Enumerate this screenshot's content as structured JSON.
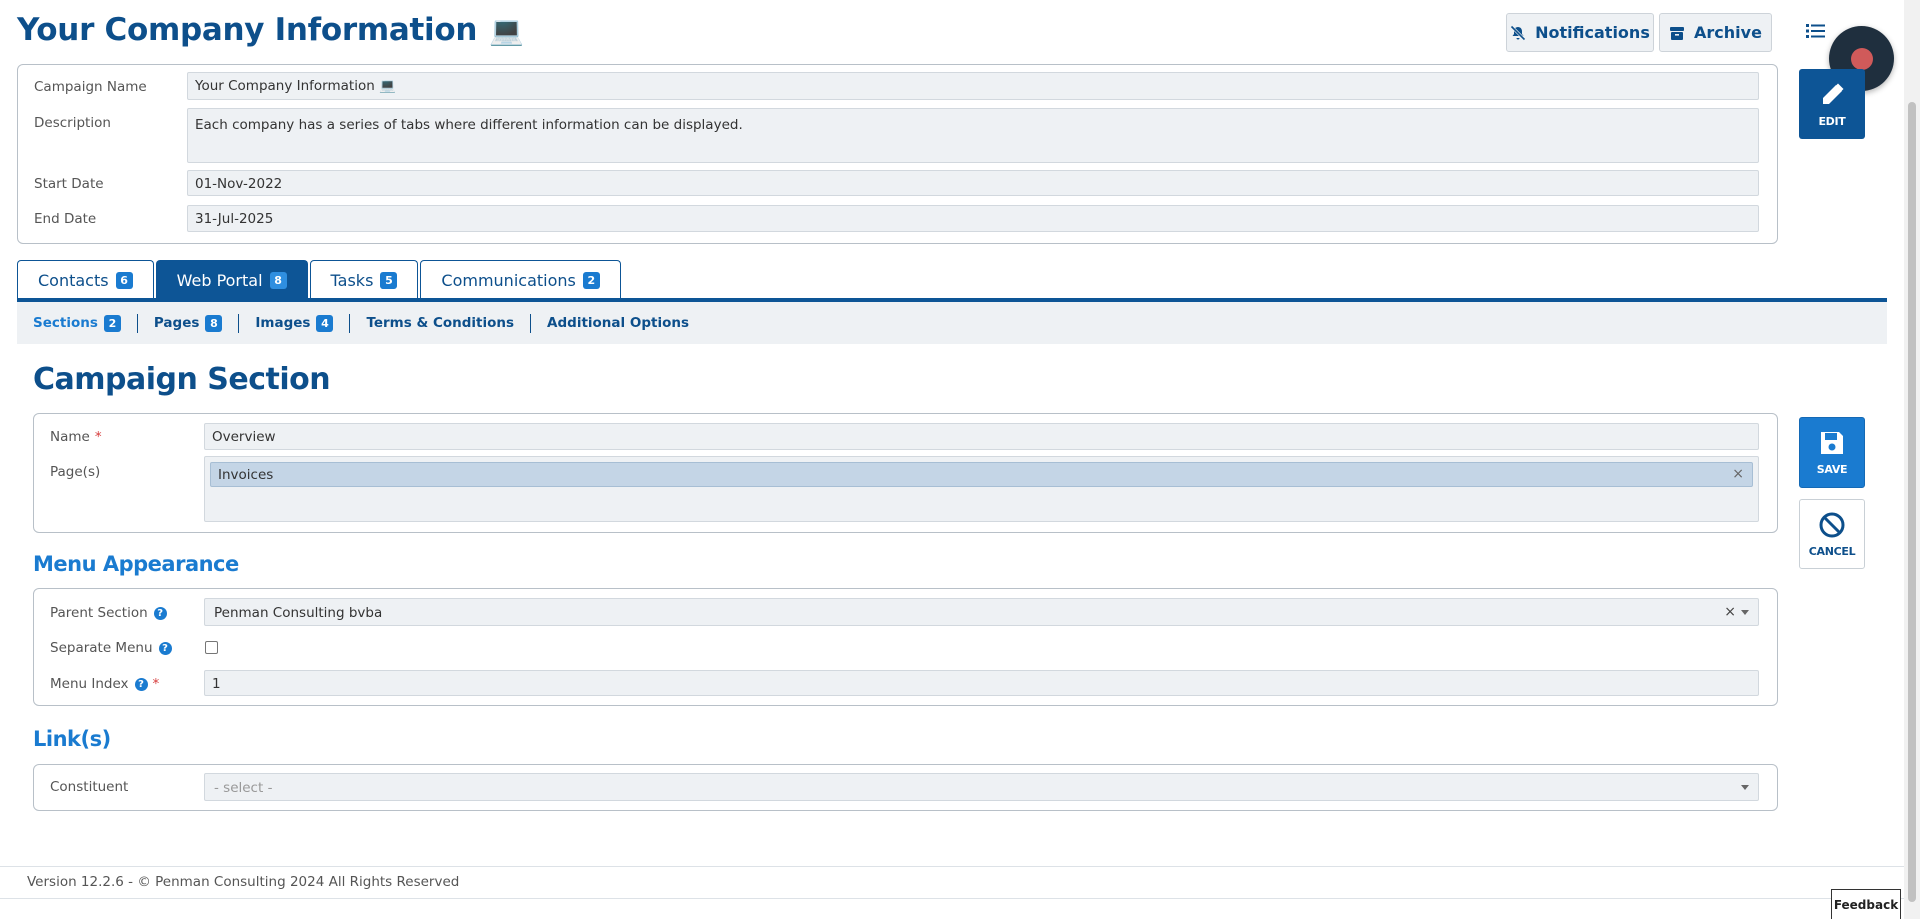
{
  "page": {
    "title": "Your Company Information",
    "title_icon": "laptop-emoji"
  },
  "toolbar": {
    "notifications_label": "Notifications",
    "archive_label": "Archive"
  },
  "campaign": {
    "name_label": "Campaign Name",
    "name_value": "Your Company Information 💻",
    "description_label": "Description",
    "description_value": "Each company has a series of tabs where different information can be displayed.",
    "start_label": "Start Date",
    "start_value": "01-Nov-2022",
    "end_label": "End Date",
    "end_value": "31-Jul-2025"
  },
  "side_buttons": {
    "edit_label": "EDIT",
    "save_label": "SAVE",
    "cancel_label": "CANCEL"
  },
  "tabs": [
    {
      "label": "Contacts",
      "count": "6",
      "active": false
    },
    {
      "label": "Web Portal",
      "count": "8",
      "active": true
    },
    {
      "label": "Tasks",
      "count": "5",
      "active": false
    },
    {
      "label": "Communications",
      "count": "2",
      "active": false
    }
  ],
  "subnav": [
    {
      "label": "Sections",
      "count": "2"
    },
    {
      "label": "Pages",
      "count": "8"
    },
    {
      "label": "Images",
      "count": "4"
    },
    {
      "label": "Terms & Conditions",
      "count": ""
    },
    {
      "label": "Additional Options",
      "count": ""
    }
  ],
  "section": {
    "heading": "Campaign Section",
    "name_label": "Name",
    "required_mark": "*",
    "name_value": "Overview",
    "pages_label": "Page(s)",
    "pages_tag": "Invoices",
    "tag_remove": "×"
  },
  "menu": {
    "heading": "Menu Appearance",
    "help_mark": "?",
    "parent_label": "Parent Section",
    "parent_value": "Penman Consulting bvba",
    "clear_mark": "×",
    "separate_label": "Separate Menu",
    "index_label": "Menu Index",
    "index_value": "1"
  },
  "links": {
    "heading": "Link(s)",
    "constituent_label": "Constituent",
    "constituent_placeholder": "- select -"
  },
  "footer": {
    "text": "Version 12.2.6 - © Penman Consulting 2024 All Rights Reserved",
    "feedback_label": "Feedback"
  },
  "colors": {
    "primary": "#0d4f8b",
    "accent": "#1a7bd0",
    "required": "#d63b3b",
    "field_bg": "#eef1f4"
  }
}
